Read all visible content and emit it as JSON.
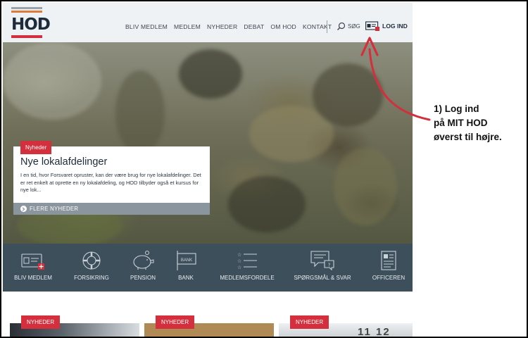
{
  "brand": {
    "logo_text": "HOD",
    "colors": {
      "accent": "#d32f3c",
      "navy": "#1d2b3a",
      "iconbar": "#3d4f5b"
    }
  },
  "header": {
    "nav": [
      {
        "label": "BLIV MEDLEM"
      },
      {
        "label": "Medlem"
      },
      {
        "label": "NYHEDER"
      },
      {
        "label": "DEBAT"
      },
      {
        "label": "OM HOD"
      },
      {
        "label": "KONTAKT"
      }
    ],
    "search_label": "SØG",
    "login_label": "LOG IND"
  },
  "hero": {
    "badge": "Nyheder",
    "title": "Nye lokalafdelinger",
    "text": "I en tid, hvor Forsvaret opruster, kan der være brug for nye lokalafdelinger. Det er ret enkelt at oprette en ny lokalafdeling, og HOD tilbyder også et kursus for nye lok...",
    "more_label": "FLERE NYHEDER"
  },
  "iconbar": {
    "items": [
      {
        "label": "BLIV MEDLEM",
        "icon": "member-card-icon"
      },
      {
        "label": "FORSIKRING",
        "icon": "lifebuoy-icon"
      },
      {
        "label": "PENSION",
        "icon": "piggy-bank-icon"
      },
      {
        "label": "BANK",
        "icon": "bank-sign-icon"
      },
      {
        "label": "MEDLEMSFORDELE",
        "icon": "list-stars-icon"
      },
      {
        "label": "SPØRGSMÅL & SVAR",
        "icon": "speech-bubble-icon"
      },
      {
        "label": "OFFICEREN",
        "icon": "magazine-icon"
      }
    ],
    "bank_sign_text": "BANK"
  },
  "teasers": {
    "badges": [
      "NYHEDER",
      "NYHEDER",
      "NYHEDER"
    ],
    "calendar_text": "11 12"
  },
  "annotation": {
    "lines": [
      "1) Log ind",
      "på MIT HOD",
      "øverst til højre."
    ],
    "color": "#d32f3c"
  }
}
